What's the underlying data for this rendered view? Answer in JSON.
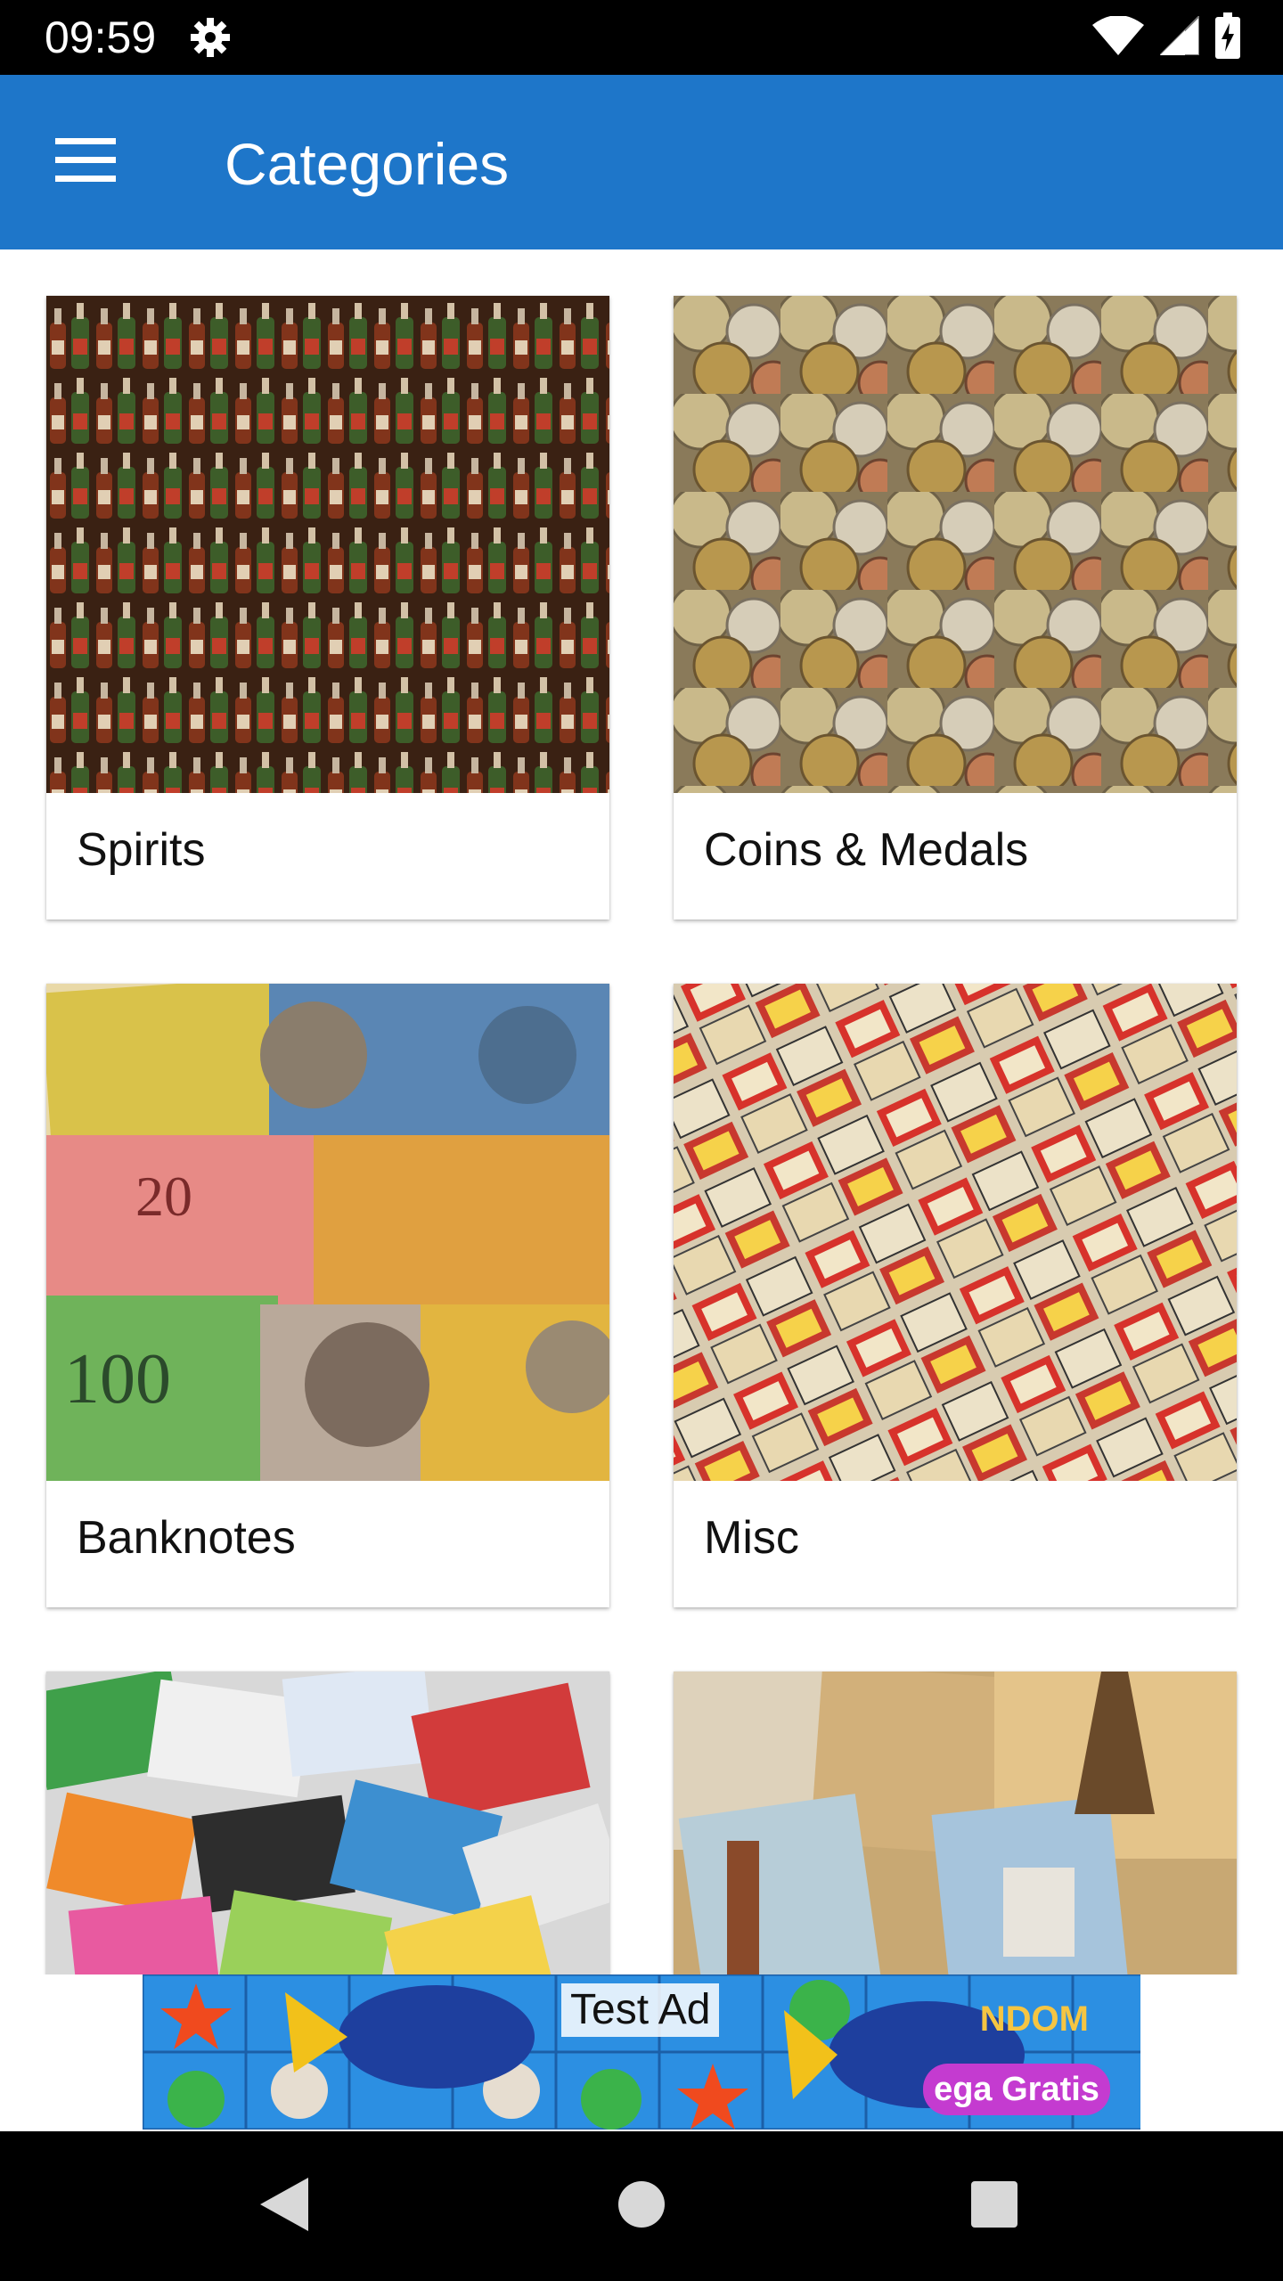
{
  "status_bar": {
    "time": "09:59",
    "icons": [
      "gear-icon",
      "wifi-icon",
      "signal-icon",
      "battery-icon"
    ]
  },
  "app_bar": {
    "title": "Categories",
    "menu_icon": "hamburger-menu-icon",
    "background": "#1e76c9"
  },
  "categories": [
    {
      "label": "Spirits",
      "image": "bottles-photo"
    },
    {
      "label": "Coins & Medals",
      "image": "coins-photo"
    },
    {
      "label": "Banknotes",
      "image": "banknotes-photo"
    },
    {
      "label": "Misc",
      "image": "matchboxes-photo"
    },
    {
      "label": "",
      "image": "phonecards-photo"
    },
    {
      "label": "",
      "image": "postcards-photo"
    }
  ],
  "ad": {
    "label": "Test Ad",
    "banner_word": "NDOM",
    "button_text": "ega Gratis"
  },
  "nav_bar": {
    "icons": [
      "back-icon",
      "home-icon",
      "recents-icon"
    ]
  }
}
